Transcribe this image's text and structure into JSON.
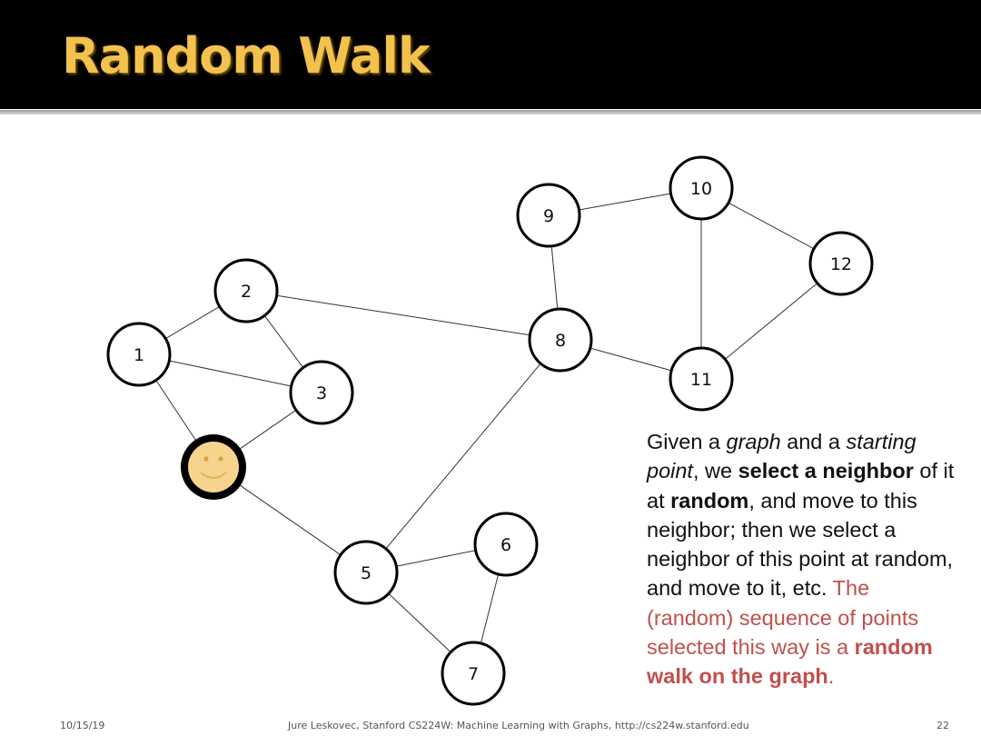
{
  "slide": {
    "title": "Random Walk",
    "footer": {
      "date": "10/15/19",
      "credit": "Jure Leskovec, Stanford CS224W: Machine Learning with Graphs, http://cs224w.stanford.edu",
      "page": "22"
    },
    "colors": {
      "title": "#f2c14e",
      "header_bg": "#000000",
      "highlight_text": "#c0504d",
      "walker_fill": "#f7d48e",
      "walker_ring": "#000000"
    }
  },
  "graph": {
    "nodes": [
      {
        "id": "1",
        "label": "1"
      },
      {
        "id": "2",
        "label": "2"
      },
      {
        "id": "3",
        "label": "3"
      },
      {
        "id": "4",
        "label": "",
        "icon": "smiley-face-icon",
        "is_walker": true
      },
      {
        "id": "5",
        "label": "5"
      },
      {
        "id": "6",
        "label": "6"
      },
      {
        "id": "7",
        "label": "7"
      },
      {
        "id": "8",
        "label": "8"
      },
      {
        "id": "9",
        "label": "9"
      },
      {
        "id": "10",
        "label": "10"
      },
      {
        "id": "11",
        "label": "11"
      },
      {
        "id": "12",
        "label": "12"
      }
    ],
    "edges": [
      [
        "1",
        "2"
      ],
      [
        "1",
        "3"
      ],
      [
        "1",
        "4"
      ],
      [
        "2",
        "3"
      ],
      [
        "2",
        "8"
      ],
      [
        "3",
        "4"
      ],
      [
        "4",
        "5"
      ],
      [
        "5",
        "8"
      ],
      [
        "5",
        "6"
      ],
      [
        "5",
        "7"
      ],
      [
        "6",
        "7"
      ],
      [
        "8",
        "9"
      ],
      [
        "8",
        "11"
      ],
      [
        "9",
        "10"
      ],
      [
        "10",
        "11"
      ],
      [
        "10",
        "12"
      ],
      [
        "11",
        "12"
      ]
    ]
  },
  "description": {
    "p1": "Given a ",
    "p1_em": "graph",
    "p2": " and a ",
    "p2_em": "starting point",
    "p3": ", we ",
    "p3_bold": "select a neighbor",
    "p4": " of it at ",
    "p4_bold": "random",
    "p5": ", and move to this neighbor; then we select a neighbor of this point at random, and move to it, etc.",
    "red1": "The (random) sequence of points selected this way is a ",
    "red_bold": "random walk on the graph",
    "red2": "."
  }
}
